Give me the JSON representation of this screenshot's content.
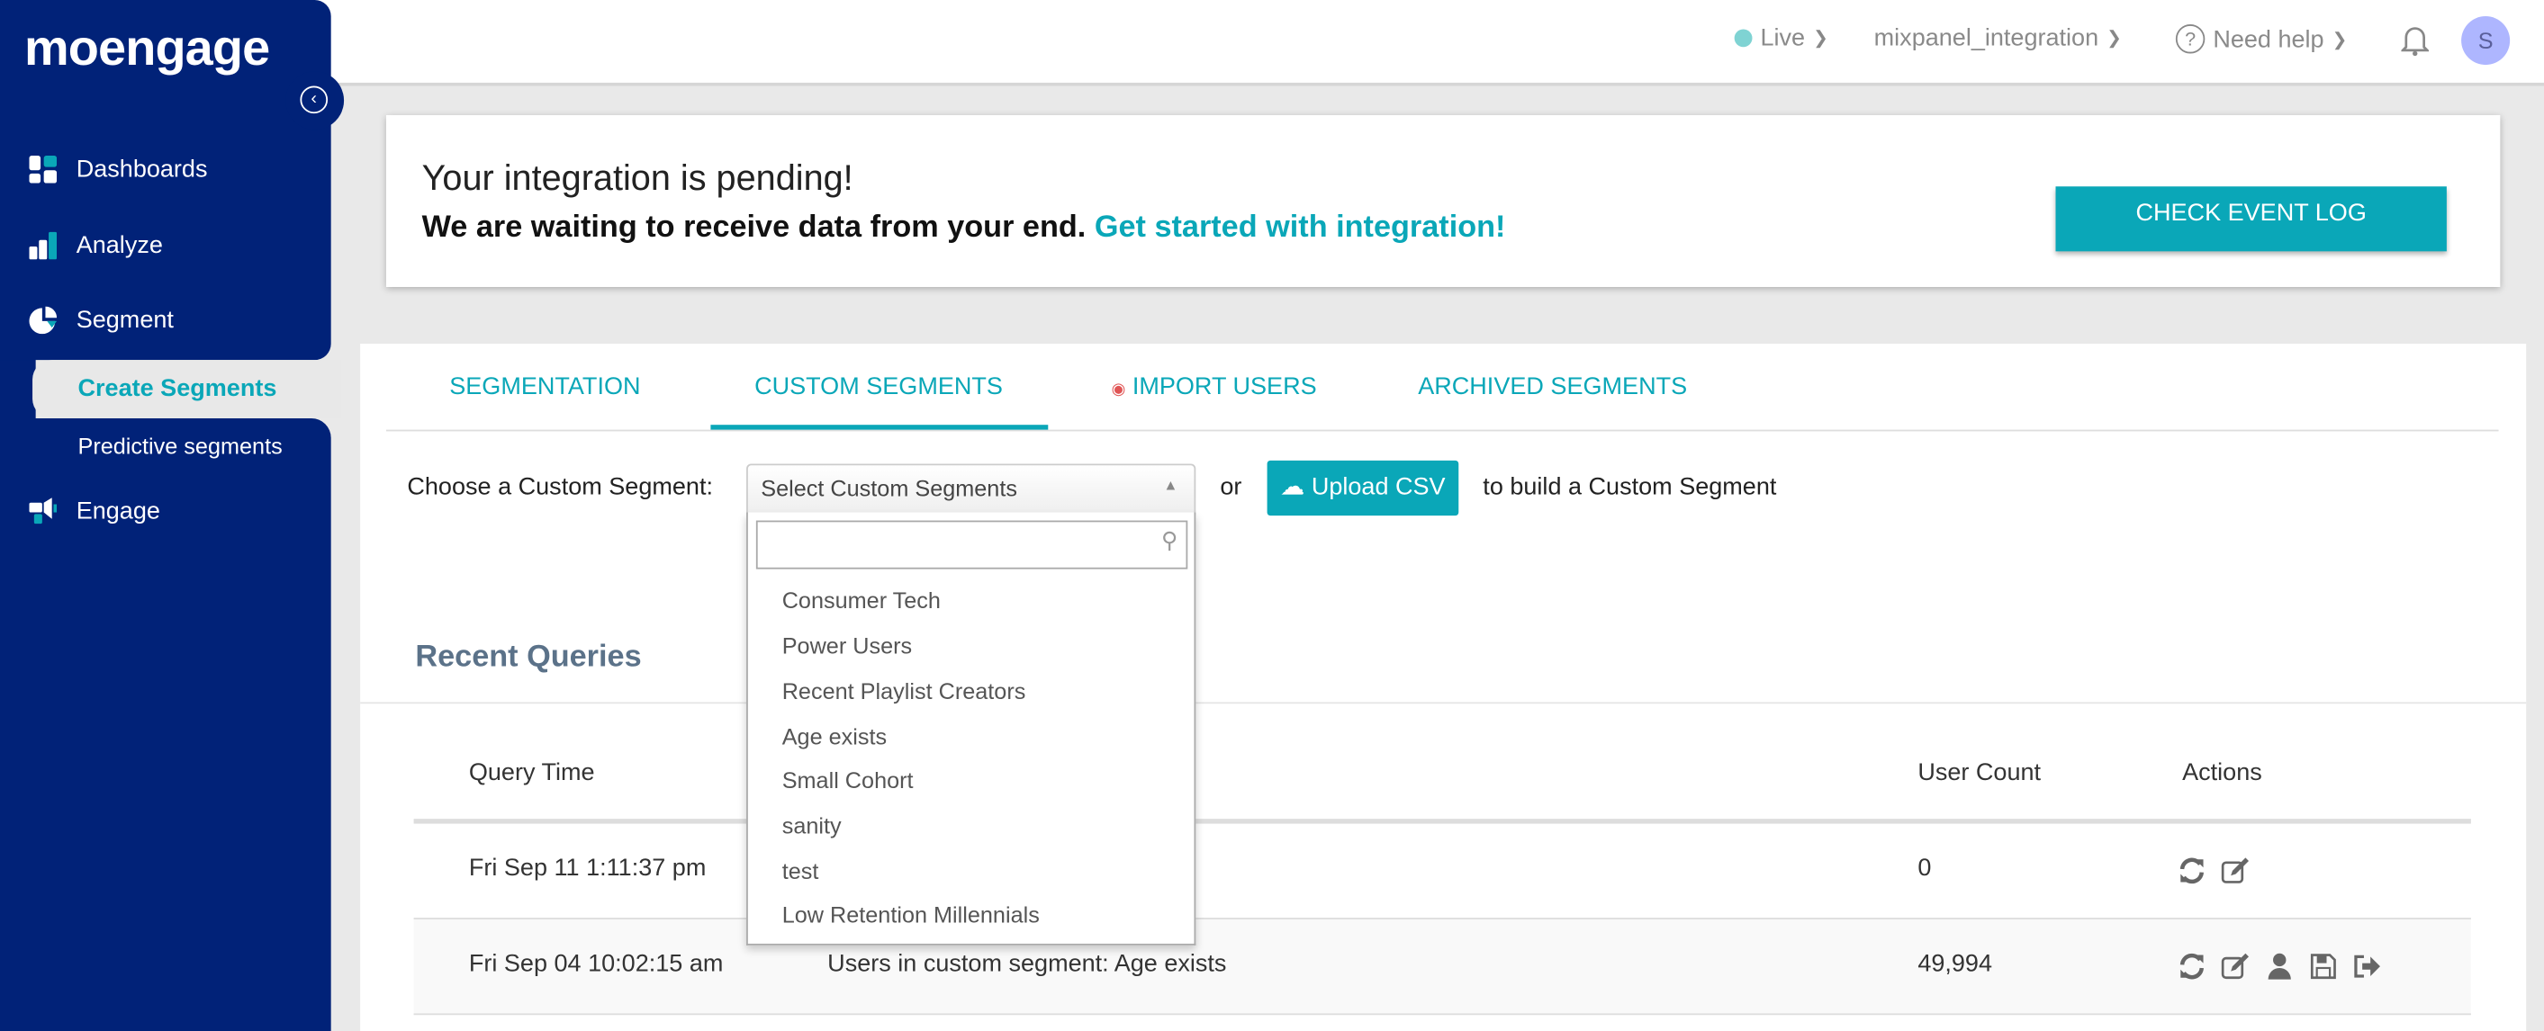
{
  "brand": {
    "logo": "moengage",
    "accent": "#0aa7b8",
    "sidebar_bg": "#012278"
  },
  "sidebar": {
    "items": [
      {
        "label": "Dashboards",
        "icon": "dashboard-icon"
      },
      {
        "label": "Analyze",
        "icon": "bar-chart-icon"
      },
      {
        "label": "Segment",
        "icon": "pie-chart-icon"
      },
      {
        "label": "Engage",
        "icon": "megaphone-icon"
      }
    ],
    "sub_items": [
      {
        "label": "Create Segments",
        "active": true
      },
      {
        "label": "Predictive segments",
        "active": false
      }
    ]
  },
  "header": {
    "env": "Live",
    "app": "mixpanel_integration",
    "help": "Need help",
    "avatar_initial": "S"
  },
  "banner": {
    "title": "Your integration is pending!",
    "message": "We are waiting to receive data from your end.",
    "link": "Get started with integration!",
    "button": "CHECK EVENT LOG"
  },
  "tabs": [
    {
      "label": "SEGMENTATION"
    },
    {
      "label": "CUSTOM SEGMENTS",
      "active": true
    },
    {
      "label": "IMPORT USERS"
    },
    {
      "label": "ARCHIVED SEGMENTS"
    }
  ],
  "chooser": {
    "label": "Choose a Custom Segment:",
    "placeholder": "Select Custom Segments",
    "or": "or",
    "upload": "Upload CSV",
    "suffix": "to build a Custom Segment",
    "search_value": "",
    "options": [
      "Consumer Tech",
      "Power Users",
      "Recent Playlist Creators",
      "Age exists",
      "Small Cohort",
      "sanity",
      "test",
      "Low Retention Millennials"
    ]
  },
  "recent": {
    "title": "Recent Queries",
    "columns": [
      "Query Time",
      "User Count",
      "Actions"
    ],
    "rows": [
      {
        "time": "Fri Sep 11 1:11:37 pm",
        "description": "",
        "count": "0",
        "actions": [
          "refresh-icon",
          "edit-icon"
        ]
      },
      {
        "time": "Fri Sep 04 10:02:15 am",
        "description": "Users in custom segment: Age exists",
        "count": "49,994",
        "actions": [
          "refresh-icon",
          "edit-icon",
          "user-icon",
          "save-icon",
          "export-icon"
        ]
      }
    ]
  }
}
